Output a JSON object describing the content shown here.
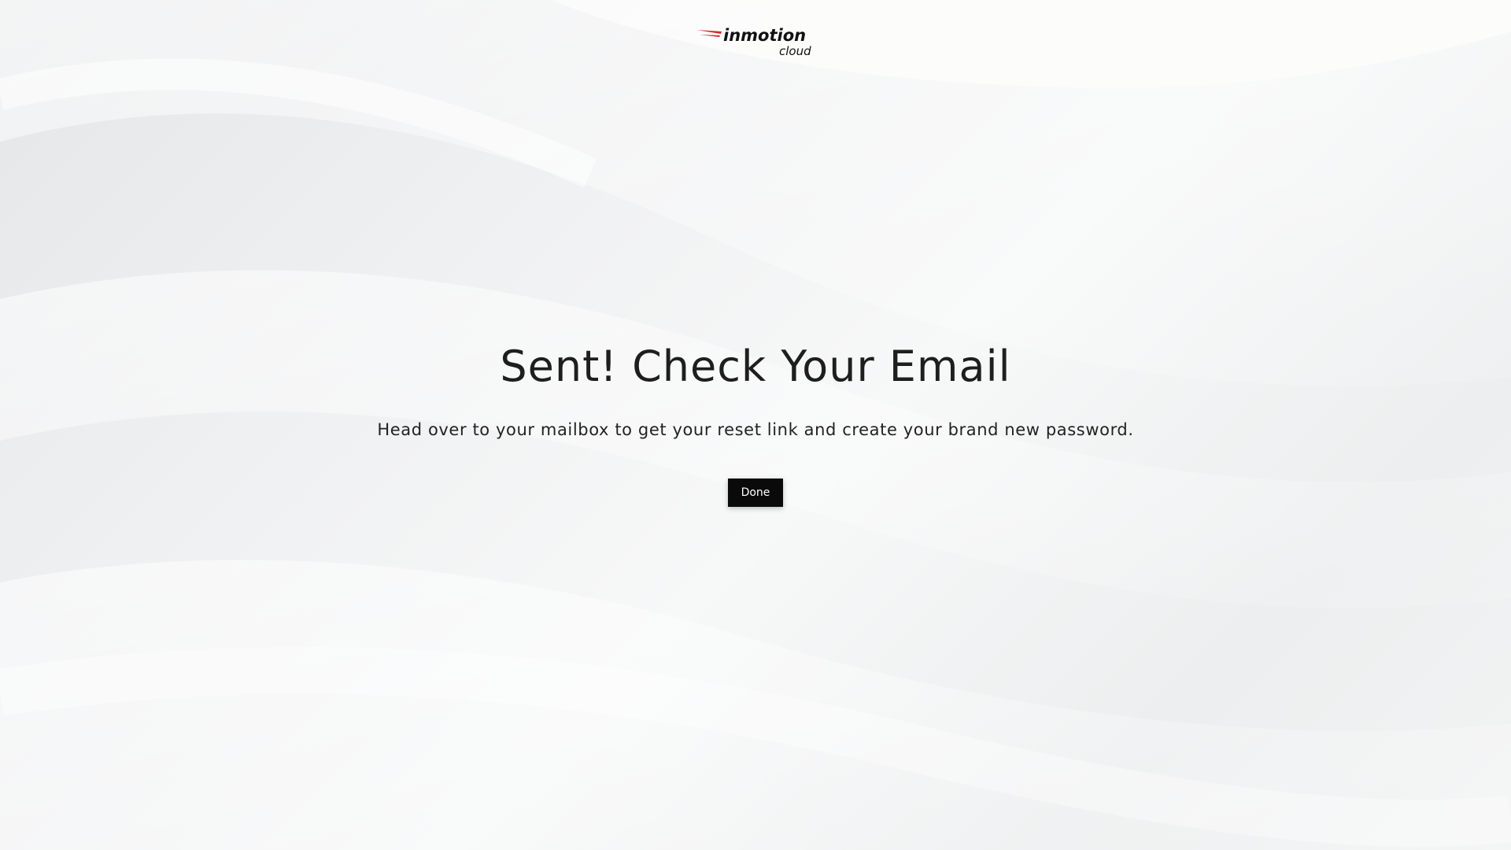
{
  "logo": {
    "primary_text": "inmotion",
    "secondary_text": "cloud",
    "accent_color": "#d9262b"
  },
  "main": {
    "title": "Sent! Check Your Email",
    "message": "Head over to your mailbox to get your reset link and create your brand new password.",
    "done_label": "Done"
  },
  "colors": {
    "text": "#1e1e1e",
    "button_bg": "#0a0a0a",
    "button_text": "#ffffff"
  }
}
